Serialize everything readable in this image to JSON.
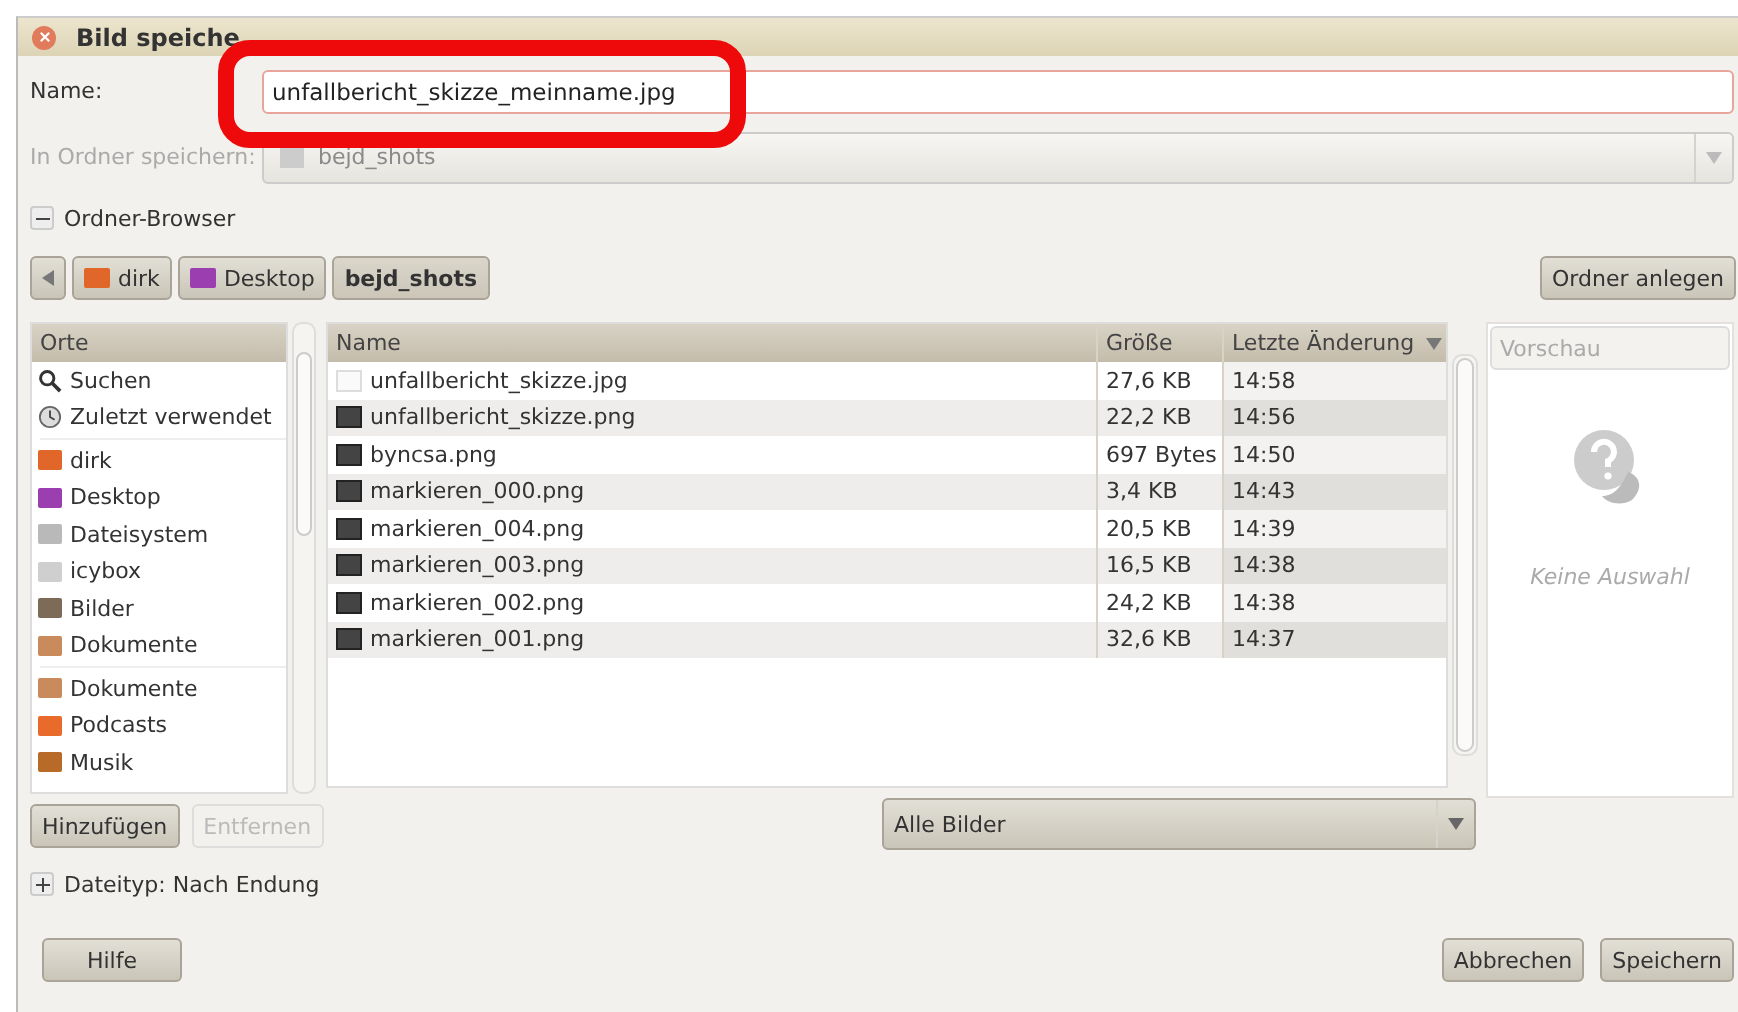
{
  "window": {
    "title": "Bild speiche"
  },
  "name_field": {
    "label": "Name:",
    "value": "unfallbericht_skizze_meinname.jpg"
  },
  "folder_field": {
    "label": "In Ordner speichern:",
    "value": "bejd_shots",
    "disabled": true
  },
  "folder_browser": {
    "label": "Ordner-Browser",
    "expanded": true
  },
  "path_bar": {
    "segments": [
      {
        "label": "dirk",
        "kind": "home",
        "selected": false
      },
      {
        "label": "Desktop",
        "kind": "desktop",
        "selected": false
      },
      {
        "label": "bejd_shots",
        "kind": "plain",
        "selected": true
      }
    ],
    "create_folder": "Ordner anlegen"
  },
  "places": {
    "heading": "Orte",
    "groups": [
      [
        {
          "label": "Suchen",
          "kind": "search"
        },
        {
          "label": "Zuletzt verwendet",
          "kind": "recent"
        }
      ],
      [
        {
          "label": "dirk",
          "kind": "home"
        },
        {
          "label": "Desktop",
          "kind": "desktop"
        },
        {
          "label": "Dateisystem",
          "kind": "drive"
        },
        {
          "label": "icybox",
          "kind": "usb"
        },
        {
          "label": "Bilder",
          "kind": "pictures"
        },
        {
          "label": "Dokumente",
          "kind": "documents"
        }
      ],
      [
        {
          "label": "Dokumente",
          "kind": "documents"
        },
        {
          "label": "Podcasts",
          "kind": "folder"
        },
        {
          "label": "Musik",
          "kind": "music"
        }
      ]
    ],
    "add": "Hinzufügen",
    "remove": "Entfernen",
    "remove_disabled": true
  },
  "files": {
    "columns": [
      "Name",
      "Größe",
      "Letzte Änderung"
    ],
    "rows": [
      {
        "name": "unfallbericht_skizze.jpg",
        "size": "27,6 KB",
        "modified": "14:58",
        "kind": "jpg"
      },
      {
        "name": "unfallbericht_skizze.png",
        "size": "22,2 KB",
        "modified": "14:56",
        "kind": "png"
      },
      {
        "name": "byncsa.png",
        "size": "697 Bytes",
        "modified": "14:50",
        "kind": "png"
      },
      {
        "name": "markieren_000.png",
        "size": "3,4 KB",
        "modified": "14:43",
        "kind": "png"
      },
      {
        "name": "markieren_004.png",
        "size": "20,5 KB",
        "modified": "14:39",
        "kind": "png"
      },
      {
        "name": "markieren_003.png",
        "size": "16,5 KB",
        "modified": "14:38",
        "kind": "png"
      },
      {
        "name": "markieren_002.png",
        "size": "24,2 KB",
        "modified": "14:38",
        "kind": "png"
      },
      {
        "name": "markieren_001.png",
        "size": "32,6 KB",
        "modified": "14:37",
        "kind": "png"
      }
    ]
  },
  "preview": {
    "heading": "Vorschau",
    "message": "Keine Auswahl"
  },
  "filter": {
    "value": "Alle Bilder"
  },
  "file_type": {
    "label": "Dateityp: Nach Endung",
    "expanded": false
  },
  "buttons": {
    "help": "Hilfe",
    "cancel": "Abbrechen",
    "save": "Speichern"
  }
}
